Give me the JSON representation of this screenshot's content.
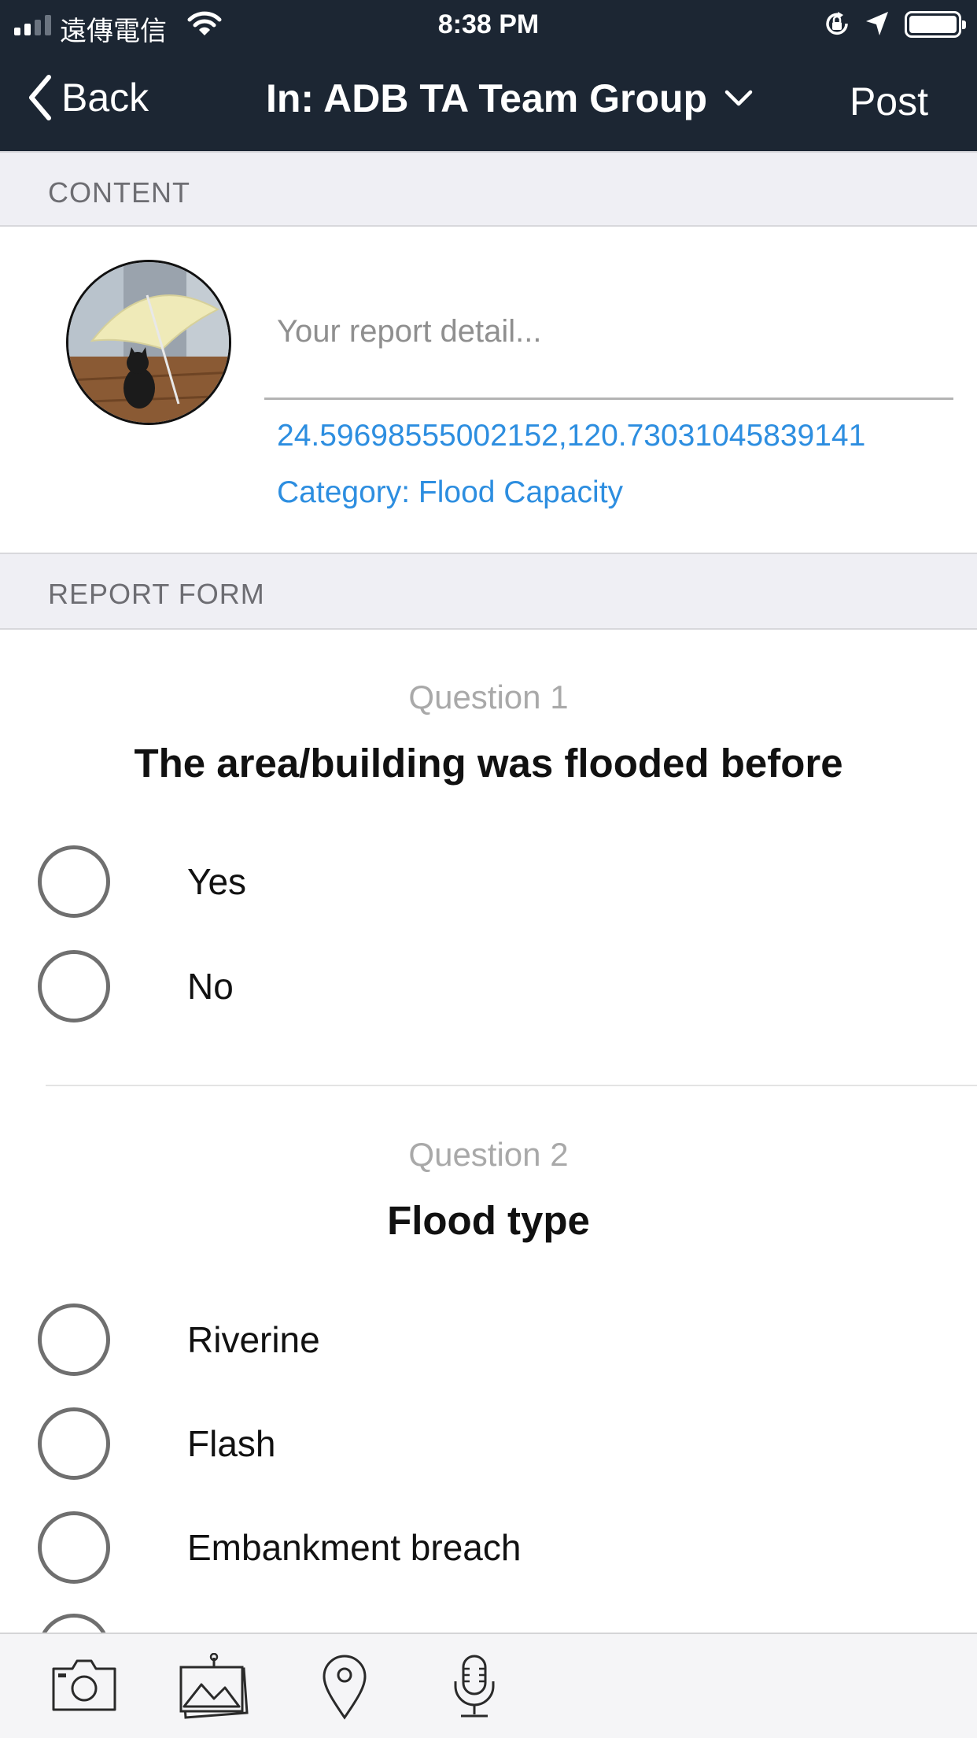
{
  "status_bar": {
    "carrier": "遠傳電信",
    "time": "8:38 PM"
  },
  "nav": {
    "back_label": "Back",
    "title": "In: ADB TA Team Group",
    "post_label": "Post"
  },
  "content_section": {
    "header": "CONTENT",
    "report_placeholder": "Your report detail...",
    "coordinates": "24.59698555002152,120.73031045839141",
    "category": "Category: Flood Capacity"
  },
  "form_section": {
    "header": "REPORT FORM",
    "questions": [
      {
        "number": "Question 1",
        "title": "The area/building was flooded before",
        "options": [
          "Yes",
          "No"
        ]
      },
      {
        "number": "Question 2",
        "title": "Flood type",
        "options": [
          "Riverine",
          "Flash",
          "Embankment breach"
        ]
      }
    ]
  },
  "toolbar": {
    "items": [
      "camera-icon",
      "gallery-icon",
      "location-pin-icon",
      "microphone-icon"
    ]
  },
  "colors": {
    "nav_background": "#1c2633",
    "link_blue": "#2d8ee0",
    "section_background": "#efeff4"
  }
}
